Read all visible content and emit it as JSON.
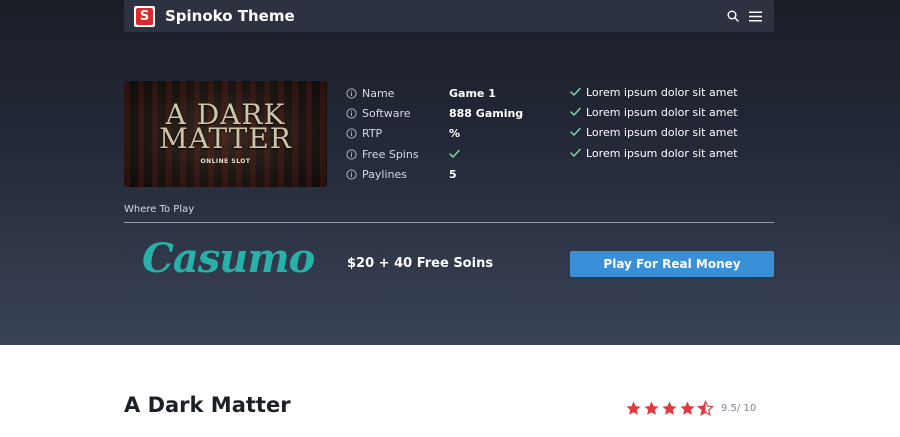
{
  "header": {
    "logo_letter": "S",
    "site_title": "Spinoko Theme",
    "icons": [
      "search-icon",
      "menu-icon"
    ]
  },
  "game_image": {
    "art_line1": "A DARK",
    "art_line2": "MATTER",
    "art_sub": "ONLINE SLOT"
  },
  "info": {
    "rows": [
      {
        "label": "Name",
        "value": "Game 1"
      },
      {
        "label": "Software",
        "value": "888 Gaming"
      },
      {
        "label": "RTP",
        "value": "%"
      },
      {
        "label": "Free Spins",
        "value": ""
      },
      {
        "label": "Paylines",
        "value": "5"
      }
    ]
  },
  "features": [
    "Lorem ipsum dolor sit amet",
    "Lorem ipsum dolor sit amet",
    "Lorem ipsum dolor sit amet",
    "Lorem ipsum dolor sit amet"
  ],
  "where_to_play": {
    "label": "Where To Play",
    "casino_name": "Casumo",
    "bonus": "$20 + 40 Free Soins",
    "button_label": "Play For Real Money"
  },
  "game": {
    "title": "A Dark Matter",
    "rating_text": "9.5/ 10",
    "stars": 4.5
  },
  "colors": {
    "accent_blue": "#3a8fd9",
    "check_green": "#7fd7a0",
    "star_red": "#e0393e",
    "casino_teal": "#27b1a9",
    "logo_red": "#d92b2b"
  }
}
